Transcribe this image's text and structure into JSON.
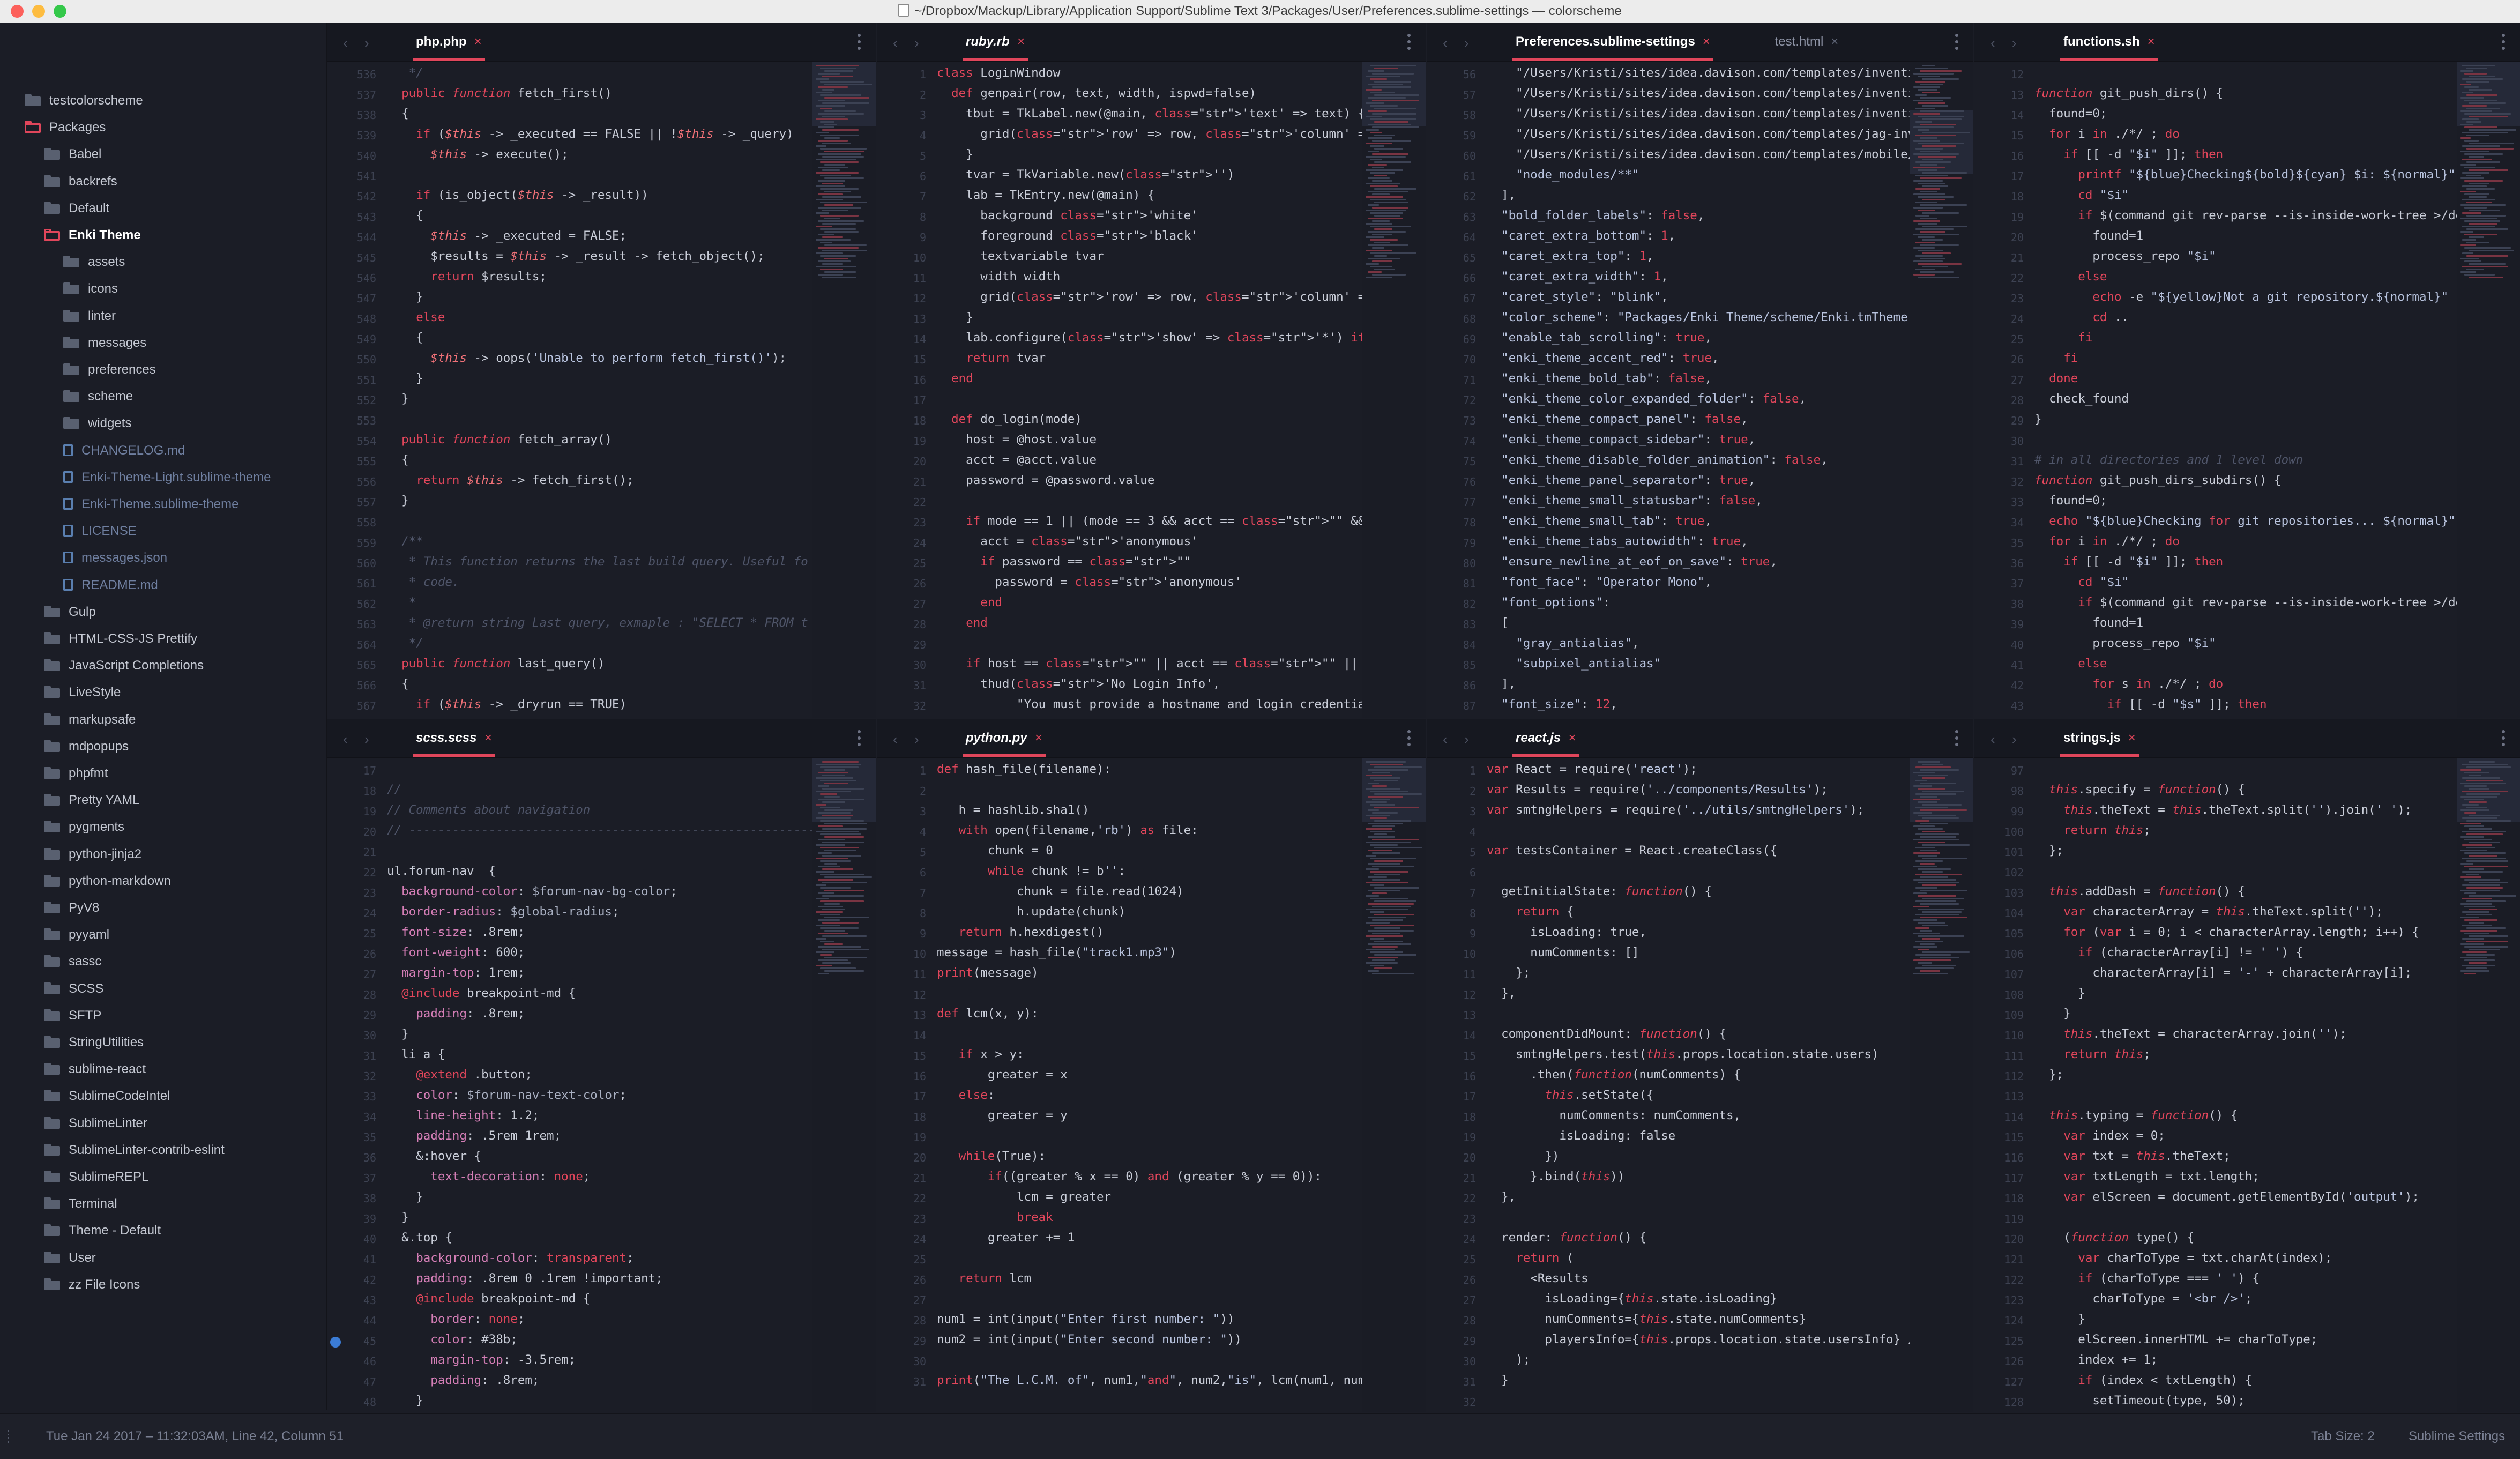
{
  "window": {
    "title": "~/Dropbox/Mackup/Library/Application Support/Sublime Text 3/Packages/User/Preferences.sublime-settings — colorscheme"
  },
  "sidebar": {
    "items": [
      {
        "label": "testcolorscheme",
        "type": "folder",
        "depth": 0
      },
      {
        "label": "Packages",
        "type": "folder-open",
        "depth": 0
      },
      {
        "label": "Babel",
        "type": "folder",
        "depth": 1
      },
      {
        "label": "backrefs",
        "type": "folder",
        "depth": 1
      },
      {
        "label": "Default",
        "type": "folder",
        "depth": 1
      },
      {
        "label": "Enki Theme",
        "type": "folder-open",
        "depth": 1,
        "active": true
      },
      {
        "label": "assets",
        "type": "folder",
        "depth": 2
      },
      {
        "label": "icons",
        "type": "folder",
        "depth": 2
      },
      {
        "label": "linter",
        "type": "folder",
        "depth": 2
      },
      {
        "label": "messages",
        "type": "folder",
        "depth": 2
      },
      {
        "label": "preferences",
        "type": "folder",
        "depth": 2
      },
      {
        "label": "scheme",
        "type": "folder",
        "depth": 2
      },
      {
        "label": "widgets",
        "type": "folder",
        "depth": 2
      },
      {
        "label": "CHANGELOG.md",
        "type": "file",
        "depth": 2
      },
      {
        "label": "Enki-Theme-Light.sublime-theme",
        "type": "file",
        "depth": 2
      },
      {
        "label": "Enki-Theme.sublime-theme",
        "type": "file",
        "depth": 2
      },
      {
        "label": "LICENSE",
        "type": "file",
        "depth": 2
      },
      {
        "label": "messages.json",
        "type": "file",
        "depth": 2
      },
      {
        "label": "README.md",
        "type": "file",
        "depth": 2
      },
      {
        "label": "Gulp",
        "type": "folder",
        "depth": 1
      },
      {
        "label": "HTML-CSS-JS Prettify",
        "type": "folder",
        "depth": 1
      },
      {
        "label": "JavaScript Completions",
        "type": "folder",
        "depth": 1
      },
      {
        "label": "LiveStyle",
        "type": "folder",
        "depth": 1
      },
      {
        "label": "markupsafe",
        "type": "folder",
        "depth": 1
      },
      {
        "label": "mdpopups",
        "type": "folder",
        "depth": 1
      },
      {
        "label": "phpfmt",
        "type": "folder",
        "depth": 1
      },
      {
        "label": "Pretty YAML",
        "type": "folder",
        "depth": 1
      },
      {
        "label": "pygments",
        "type": "folder",
        "depth": 1
      },
      {
        "label": "python-jinja2",
        "type": "folder",
        "depth": 1
      },
      {
        "label": "python-markdown",
        "type": "folder",
        "depth": 1
      },
      {
        "label": "PyV8",
        "type": "folder",
        "depth": 1
      },
      {
        "label": "pyyaml",
        "type": "folder",
        "depth": 1
      },
      {
        "label": "sassc",
        "type": "folder",
        "depth": 1
      },
      {
        "label": "SCSS",
        "type": "folder",
        "depth": 1
      },
      {
        "label": "SFTP",
        "type": "folder",
        "depth": 1
      },
      {
        "label": "StringUtilities",
        "type": "folder",
        "depth": 1
      },
      {
        "label": "sublime-react",
        "type": "folder",
        "depth": 1
      },
      {
        "label": "SublimeCodeIntel",
        "type": "folder",
        "depth": 1
      },
      {
        "label": "SublimeLinter",
        "type": "folder",
        "depth": 1
      },
      {
        "label": "SublimeLinter-contrib-eslint",
        "type": "folder",
        "depth": 1
      },
      {
        "label": "SublimeREPL",
        "type": "folder",
        "depth": 1
      },
      {
        "label": "Terminal",
        "type": "folder",
        "depth": 1
      },
      {
        "label": "Theme - Default",
        "type": "folder",
        "depth": 1
      },
      {
        "label": "User",
        "type": "folder",
        "depth": 1
      },
      {
        "label": "zz File Icons",
        "type": "folder",
        "depth": 1
      }
    ]
  },
  "status": {
    "left": "Tue Jan 24 2017 – 11:32:03AM, Line 42, Column 51",
    "tab_size": "Tab Size: 2",
    "syntax": "Sublime Settings"
  },
  "colors": {
    "accent": "#e0465b",
    "background": "#1b1d26",
    "tabbar": "#161820"
  },
  "panes": [
    {
      "id": "php",
      "tabs": [
        {
          "label": "php.php",
          "active": true,
          "italic": false
        }
      ],
      "lines": [
        "   */",
        "  public function fetch_first()",
        "  {",
        "    if ($this -> _executed == FALSE || !$this -> _query)",
        "      $this -> execute();",
        "",
        "    if (is_object($this -> _result))",
        "    {",
        "      $this -> _executed = FALSE;",
        "      $results = $this -> _result -> fetch_object();",
        "      return $results;",
        "    }",
        "    else",
        "    {",
        "      $this -> oops('Unable to perform fetch_first()');",
        "    }",
        "  }",
        "",
        "  public function fetch_array()",
        "  {",
        "    return $this -> fetch_first();",
        "  }",
        "",
        "  /**",
        "   * This function returns the last build query. Useful fo",
        "   * code.",
        "   *",
        "   * @return string Last query, exmaple : \"SELECT * FROM t",
        "   */",
        "  public function last_query()",
        "  {",
        "    if ($this -> _dryrun == TRUE)"
      ]
    },
    {
      "id": "ruby",
      "tabs": [
        {
          "label": "ruby.rb",
          "active": true,
          "italic": true
        }
      ],
      "lines": [
        "class LoginWindow",
        "  def genpair(row, text, width, ispwd=false)",
        "    tbut = TkLabel.new(@main, 'text' => text) {",
        "      grid('row' => row, 'column' => 0, 'sticky' => 'nse')",
        "    }",
        "    tvar = TkVariable.new('')",
        "    lab = TkEntry.new(@main) {",
        "      background 'white'",
        "      foreground 'black'",
        "      textvariable tvar",
        "      width width",
        "      grid('row' => row, 'column' => 1, 'sticky' => 'nsw')",
        "    }",
        "    lab.configure('show' => '*') if ispwd",
        "    return tvar",
        "  end",
        "",
        "  def do_login(mode)",
        "    host = @host.value",
        "    acct = @acct.value",
        "    password = @password.value",
        "",
        "    if mode == 1 || (mode == 3 && acct == \"\" && password ==",
        "      acct = 'anonymous'",
        "      if password == \"\"",
        "        password = 'anonymous'",
        "      end",
        "    end",
        "",
        "    if host == \"\" || acct == \"\" || password == \"\"",
        "      thud('No Login Info',",
        "           \"You must provide a hostname and login credential"
      ]
    },
    {
      "id": "prefs",
      "tabs": [
        {
          "label": "Preferences.sublime-settings",
          "active": true,
          "italic": false
        },
        {
          "label": "test.html",
          "active": false,
          "italic": false
        }
      ],
      "lines": [
        "    \"/Users/Kristi/sites/idea.davison.com/templates/inventi",
        "    \"/Users/Kristi/sites/idea.davison.com/templates/inventi",
        "    \"/Users/Kristi/sites/idea.davison.com/templates/inventi",
        "    \"/Users/Kristi/sites/idea.davison.com/templates/jag-inv",
        "    \"/Users/Kristi/sites/idea.davison.com/templates/mobile/",
        "    \"node_modules/**\"",
        "  ],",
        "  \"bold_folder_labels\": false,",
        "  \"caret_extra_bottom\": 1,",
        "  \"caret_extra_top\": 1,",
        "  \"caret_extra_width\": 1,",
        "  \"caret_style\": \"blink\",",
        "  \"color_scheme\": \"Packages/Enki Theme/scheme/Enki.tmTheme\"",
        "  \"enable_tab_scrolling\": true,",
        "  \"enki_theme_accent_red\": true,",
        "  \"enki_theme_bold_tab\": false,",
        "  \"enki_theme_color_expanded_folder\": false,",
        "  \"enki_theme_compact_panel\": false,",
        "  \"enki_theme_compact_sidebar\": true,",
        "  \"enki_theme_disable_folder_animation\": false,",
        "  \"enki_theme_panel_separator\": true,",
        "  \"enki_theme_small_statusbar\": false,",
        "  \"enki_theme_small_tab\": true,",
        "  \"enki_theme_tabs_autowidth\": true,",
        "  \"ensure_newline_at_eof_on_save\": true,",
        "  \"font_face\": \"Operator Mono\",",
        "  \"font_options\":",
        "  [",
        "    \"gray_antialias\",",
        "    \"subpixel_antialias\"",
        "  ],",
        "  \"font_size\": 12,"
      ]
    },
    {
      "id": "shell",
      "tabs": [
        {
          "label": "functions.sh",
          "active": true,
          "italic": false
        }
      ],
      "lines": [
        "",
        "function git_push_dirs() {",
        "  found=0;",
        "  for i in ./*/ ; do",
        "    if [[ -d \"$i\" ]]; then",
        "      printf \"${blue}Checking${bold}${cyan} $i: ${normal}\"",
        "      cd \"$i\"",
        "      if $(command git rev-parse --is-inside-work-tree >/de",
        "        found=1",
        "        process_repo \"$i\"",
        "      else",
        "        echo -e \"${yellow}Not a git repository.${normal}\"",
        "        cd ..",
        "      fi",
        "    fi",
        "  done",
        "  check_found",
        "}",
        "",
        "# in all directories and 1 level down",
        "function git_push_dirs_subdirs() {",
        "  found=0;",
        "  echo \"${blue}Checking for git repositories... ${normal}\"",
        "  for i in ./*/ ; do",
        "    if [[ -d \"$i\" ]]; then",
        "      cd \"$i\"",
        "      if $(command git rev-parse --is-inside-work-tree >/de",
        "        found=1",
        "        process_repo \"$i\"",
        "      else",
        "        for s in ./*/ ; do",
        "          if [[ -d \"$s\" ]]; then"
      ]
    },
    {
      "id": "scss",
      "tabs": [
        {
          "label": "scss.scss",
          "active": true,
          "italic": true
        }
      ],
      "lines": [
        "",
        "//",
        "// Comments about navigation",
        "// --------------------------------------------------------",
        "",
        "ul.forum-nav  {",
        "  background-color: $forum-nav-bg-color;",
        "  border-radius: $global-radius;",
        "  font-size: .8rem;",
        "  font-weight: 600;",
        "  margin-top: 1rem;",
        "  @include breakpoint-md {",
        "    padding: .8rem;",
        "  }",
        "  li a {",
        "    @extend .button;",
        "    color: $forum-nav-text-color;",
        "    line-height: 1.2;",
        "    padding: .5rem 1rem;",
        "    &:hover {",
        "      text-decoration: none;",
        "    }",
        "  }",
        "  &.top {",
        "    background-color: transparent;",
        "    padding: .8rem 0 .1rem !important;",
        "    @include breakpoint-md {",
        "      border: none;",
        "      color: #38b;",
        "      margin-top: -3.5rem;",
        "      padding: .8rem;",
        "    }"
      ]
    },
    {
      "id": "python",
      "tabs": [
        {
          "label": "python.py",
          "active": true,
          "italic": true
        }
      ],
      "lines": [
        "def hash_file(filename):",
        "",
        "   h = hashlib.sha1()",
        "   with open(filename,'rb') as file:",
        "       chunk = 0",
        "       while chunk != b'':",
        "           chunk = file.read(1024)",
        "           h.update(chunk)",
        "   return h.hexdigest()",
        "message = hash_file(\"track1.mp3\")",
        "print(message)",
        "",
        "def lcm(x, y):",
        "",
        "   if x > y:",
        "       greater = x",
        "   else:",
        "       greater = y",
        "",
        "   while(True):",
        "       if((greater % x == 0) and (greater % y == 0)):",
        "           lcm = greater",
        "           break",
        "       greater += 1",
        "",
        "   return lcm",
        "",
        "num1 = int(input(\"Enter first number: \"))",
        "num2 = int(input(\"Enter second number: \"))",
        "",
        "print(\"The L.C.M. of\", num1,\"and\", num2,\"is\", lcm(num1, num2"
      ]
    },
    {
      "id": "react",
      "tabs": [
        {
          "label": "react.js",
          "active": true,
          "italic": true
        }
      ],
      "lines": [
        "var React = require('react');",
        "var Results = require('../components/Results');",
        "var smtngHelpers = require('../utils/smtngHelpers');",
        "",
        "var testsContainer = React.createClass({",
        "",
        "  getInitialState: function() {",
        "    return {",
        "      isLoading: true,",
        "      numComments: []",
        "    };",
        "  },",
        "",
        "  componentDidMount: function() {",
        "    smtngHelpers.test(this.props.location.state.users)",
        "      .then(function(numComments) {",
        "        this.setState({",
        "          numComments: numComments,",
        "          isLoading: false",
        "        })",
        "      }.bind(this))",
        "  },",
        "",
        "  render: function() {",
        "    return (",
        "      <Results",
        "        isLoading={this.state.isLoading}",
        "        numComments={this.state.numComments}",
        "        playersInfo={this.props.location.state.usersInfo} />",
        "    );",
        "  }",
        ""
      ]
    },
    {
      "id": "strings",
      "tabs": [
        {
          "label": "strings.js",
          "active": true,
          "italic": false
        }
      ],
      "lines": [
        "",
        "  this.specify = function() {",
        "    this.theText = this.theText.split('').join(' ');",
        "    return this;",
        "  };",
        "",
        "  this.addDash = function() {",
        "    var characterArray = this.theText.split('');",
        "    for (var i = 0; i < characterArray.length; i++) {",
        "      if (characterArray[i] != ' ') {",
        "        characterArray[i] = '-' + characterArray[i];",
        "      }",
        "    }",
        "    this.theText = characterArray.join('');",
        "    return this;",
        "  };",
        "",
        "  this.typing = function() {",
        "    var index = 0;",
        "    var txt = this.theText;",
        "    var txtLength = txt.length;",
        "    var elScreen = document.getElementById('output');",
        "",
        "    (function type() {",
        "      var charToType = txt.charAt(index);",
        "      if (charToType === ' ') {",
        "        charToType = '<br />';",
        "      }",
        "      elScreen.innerHTML += charToType;",
        "      index += 1;",
        "      if (index < txtLength) {",
        "        setTimeout(type, 50);"
      ]
    }
  ]
}
